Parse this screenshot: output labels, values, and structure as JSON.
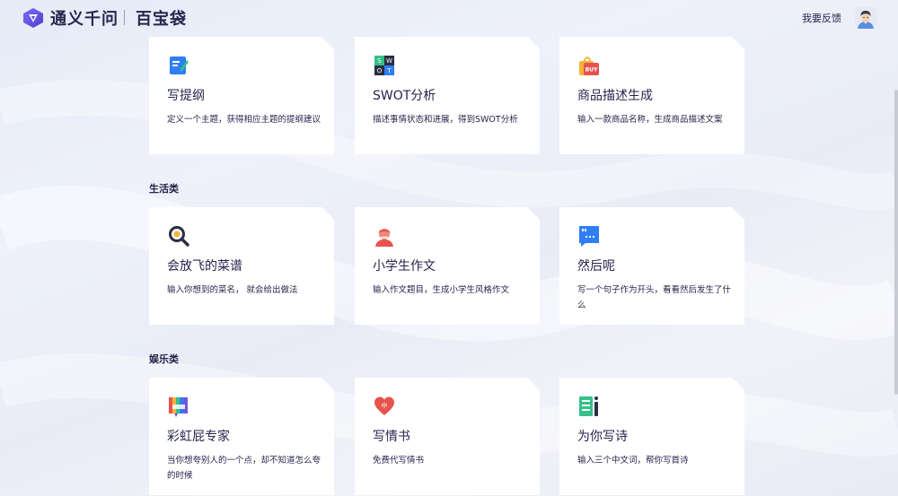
{
  "header": {
    "brand": "通义千问",
    "sub_brand": "百宝袋",
    "feedback_label": "我要反馈"
  },
  "sections": [
    {
      "title": ""
    },
    {
      "title": "生活类"
    },
    {
      "title": "娱乐类"
    }
  ],
  "cards": [
    {
      "title": "写提纲",
      "desc": "定义一个主题，获得相应主题的提纲建议",
      "icon": "outline-edit-icon"
    },
    {
      "title": "SWOT分析",
      "desc": "描述事情状态和进展，得到SWOT分析",
      "icon": "swot-grid-icon",
      "icon_letters": [
        "S",
        "W",
        "O",
        "T"
      ]
    },
    {
      "title": "商品描述生成",
      "desc": "输入一款商品名称，生成商品描述文案",
      "icon": "shopping-bag-icon",
      "icon_text": "BUY"
    },
    {
      "title": "会放飞的菜谱",
      "desc": "输入你想到的菜名， 就会给出做法",
      "icon": "magnifier-icon"
    },
    {
      "title": "小学生作文",
      "desc": "输入作文题目，生成小学生风格作文",
      "icon": "student-icon"
    },
    {
      "title": "然后呢",
      "desc": "写一个句子作为开头，看看然后发生了什么",
      "icon": "quote-bubble-icon"
    },
    {
      "title": "彩虹屁专家",
      "desc": "当你想夸别人的一个点，却不知道怎么夸的时候",
      "icon": "rainbow-icon"
    },
    {
      "title": "写情书",
      "desc": "免费代写情书",
      "icon": "heart-icon",
      "icon_text": "中"
    },
    {
      "title": "为你写诗",
      "desc": "输入三个中文词，帮你写首诗",
      "icon": "poem-icon"
    }
  ],
  "colors": {
    "text": "#26244c",
    "accent_blue": "#2f7ef5",
    "red": "#e8524d",
    "green": "#35c08a",
    "purple": "#6d57e0"
  }
}
